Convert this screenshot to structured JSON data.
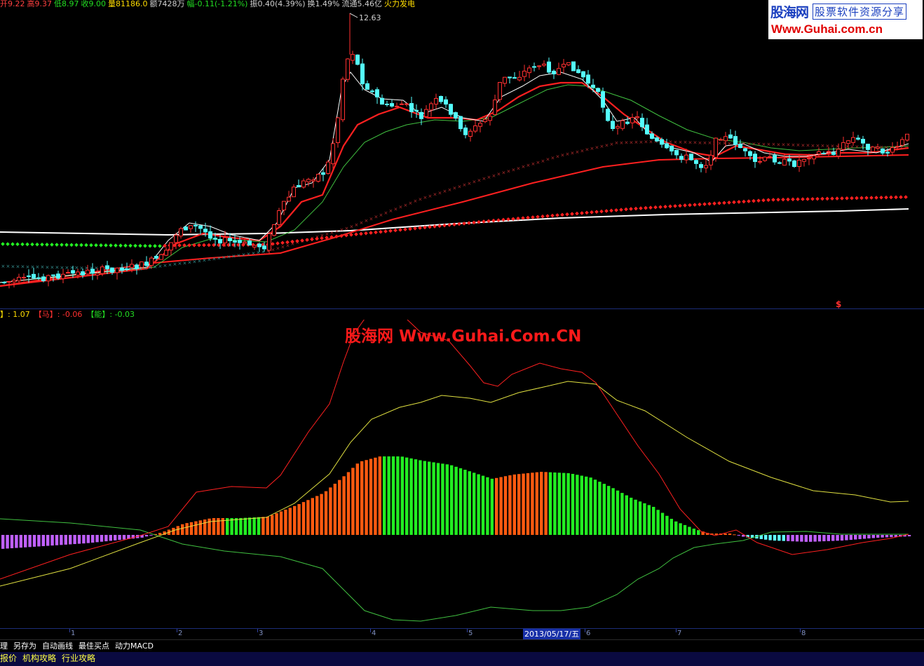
{
  "quote_bar": {
    "items": [
      {
        "text": "开9.22",
        "color": "#ff4040"
      },
      {
        "text": "高9.37",
        "color": "#ff4040"
      },
      {
        "text": "低8.97",
        "color": "#22dd22"
      },
      {
        "text": "收9.00",
        "color": "#22dd22"
      },
      {
        "text": "量81186.0",
        "color": "#ffdd00"
      },
      {
        "text": "额7428万",
        "color": "#d0d0d0"
      },
      {
        "text": "幅-0.11(-1.21%)",
        "color": "#22dd22"
      },
      {
        "text": "振0.40(4.39%)",
        "color": "#d0d0d0"
      },
      {
        "text": "换1.49%",
        "color": "#d0d0d0"
      },
      {
        "text": "流通5.46亿",
        "color": "#d0d0d0"
      },
      {
        "text": "火力发电",
        "color": "#ffdd00"
      }
    ]
  },
  "logo": {
    "name": "股海网",
    "slogan": "股票软件资源分享",
    "url": "Www.Guhai.com.cn"
  },
  "main_chart": {
    "high_label": "12.63",
    "marker": "$"
  },
  "indicator_legend": {
    "items": [
      {
        "text": "】: 1.07",
        "color": "#ffdd00"
      },
      {
        "text": "【马】: -0.06",
        "color": "#ff3030"
      },
      {
        "text": "【能】: -0.03",
        "color": "#22dd22"
      }
    ]
  },
  "watermark": "股海网 Www.Guhai.Com.CN",
  "time_axis": {
    "ticks": [
      "1",
      "2",
      "3",
      "4",
      "5",
      "6",
      "7",
      "8"
    ],
    "cursor_date": "2013/05/17/五"
  },
  "toolbar": {
    "items": [
      "理",
      "另存为",
      "自动画线",
      "最佳买点",
      "动力MACD"
    ]
  },
  "tabs": {
    "items": [
      "报价",
      "机构攻略",
      "行业攻略"
    ]
  },
  "colors": {
    "up": "#ff3030",
    "down": "#54ffff",
    "ma_white": "#ffffff",
    "ma_red": "#ff2020",
    "ma_green": "#40c040",
    "indicator_yellow": "#e0e040",
    "bar_orange": "#ff5a10",
    "bar_green": "#22ee22",
    "bar_violet": "#c060ff",
    "bar_cyan": "#60ffff"
  }
}
